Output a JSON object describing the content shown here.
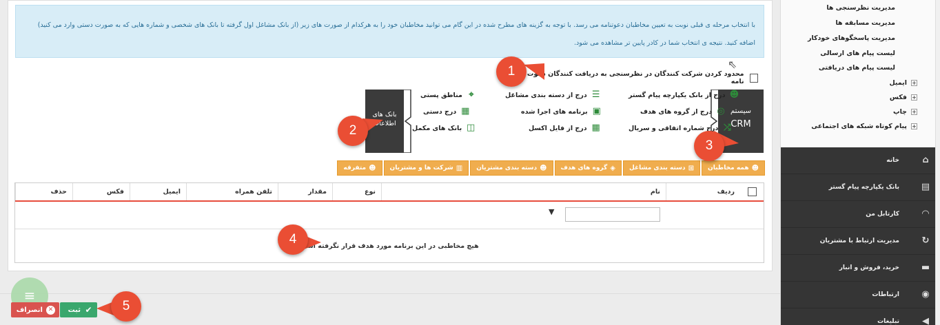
{
  "sidebar": {
    "submenu": [
      "مدیریت نظرسنجی ها",
      "مدیریت مسابقه ها",
      "مدیریت پاسخگوهای خودکار",
      "لیست پیام های ارسالی",
      "لیست پیام های دریافتی"
    ],
    "groups": [
      "ایمیل",
      "فکس",
      "چاپ",
      "پیام کوتاه شبکه های اجتماعی"
    ],
    "nav": [
      {
        "label": "خانه",
        "icon": "home-icon"
      },
      {
        "label": "بانک یکپارچه پیام گستر",
        "icon": "printer-icon"
      },
      {
        "label": "کارتابل من",
        "icon": "dashboard-icon"
      },
      {
        "label": "مدیریت ارتباط با مشتریان",
        "icon": "refresh-icon"
      },
      {
        "label": "خرید، فروش و انبار",
        "icon": "truck-icon"
      },
      {
        "label": "ارتباطات",
        "icon": "broadcast-icon"
      },
      {
        "label": "تبلیغات",
        "icon": "megaphone-icon"
      }
    ]
  },
  "info": {
    "line1": "با انتخاب مرحله ی قبلی نوبت به تعیین مخاطبان دعوتنامه می رسد. با توجه به گزینه های مطرح شده در این گام می توانید مخاطبان خود را به هرکدام از صورت های زیر (از بانک مشاغل اول گرفته تا بانک های شخصی و شماره هایی که به صورت دستی وارد می کنید)",
    "line2": "اضافه کنید. نتیجه ی انتخاب شما در کادر پایین تر مشاهده می شود."
  },
  "limit_label": "محدود کردن شرکت کنندگان در نظرسنجی به دریافت کنندگان دعوت نامه",
  "crm": {
    "line1": "سیستم",
    "line2": "CRM"
  },
  "crm_options": [
    {
      "label": "درج از بانک یکپارچه پیام گستر",
      "icon": "users-icon"
    },
    {
      "label": "درج از گروه های هدف",
      "icon": "target-icon"
    },
    {
      "label": "درج شماره اتفاقی و سریال",
      "icon": "shuffle-icon"
    },
    {
      "label": "درج از دسته بندی مشاغل",
      "icon": "list-icon"
    },
    {
      "label": "برنامه های اجرا شده",
      "icon": "save-icon"
    },
    {
      "label": "درج از فایل اکسل",
      "icon": "excel-icon"
    }
  ],
  "bank": {
    "line1": "بانک های",
    "line2": "اطلاعات"
  },
  "bank_options": [
    {
      "label": "مناطق پستی",
      "icon": "map-pin-icon"
    },
    {
      "label": "درج دستی",
      "icon": "keyboard-icon"
    },
    {
      "label": "بانک های مکمل",
      "icon": "database-icon"
    }
  ],
  "tabs": [
    {
      "label": "همه مخاطبان",
      "icon": "group-icon"
    },
    {
      "label": "دسته بندی مشاغل",
      "icon": "sitemap-icon"
    },
    {
      "label": "گروه های هدف",
      "icon": "target-icon"
    },
    {
      "label": "دسته بندی مشتریان",
      "icon": "group-icon"
    },
    {
      "label": "شرکت ها و مشتریان",
      "icon": "building-icon"
    },
    {
      "label": "متفرقه",
      "icon": "group-icon"
    }
  ],
  "table": {
    "columns": [
      "ردیف",
      "نام",
      "نوع",
      "مقدار",
      "تلفن همراه",
      "ایمیل",
      "فکس",
      "حذف"
    ],
    "empty_message": "هیچ مخاطبی در این برنامه مورد هدف قرار نگرفته است"
  },
  "footer": {
    "save_label": "ثبت",
    "cancel_label": "انصراف"
  },
  "markers": [
    "1",
    "2",
    "3",
    "4",
    "5"
  ],
  "colors": {
    "accent_orange": "#f0ad4e",
    "marker_red": "#ea4e34",
    "save_green": "#3aa76d",
    "cancel_red": "#d9534f",
    "info_bg": "#d8edf7",
    "dark_box": "#3b3b3b"
  }
}
